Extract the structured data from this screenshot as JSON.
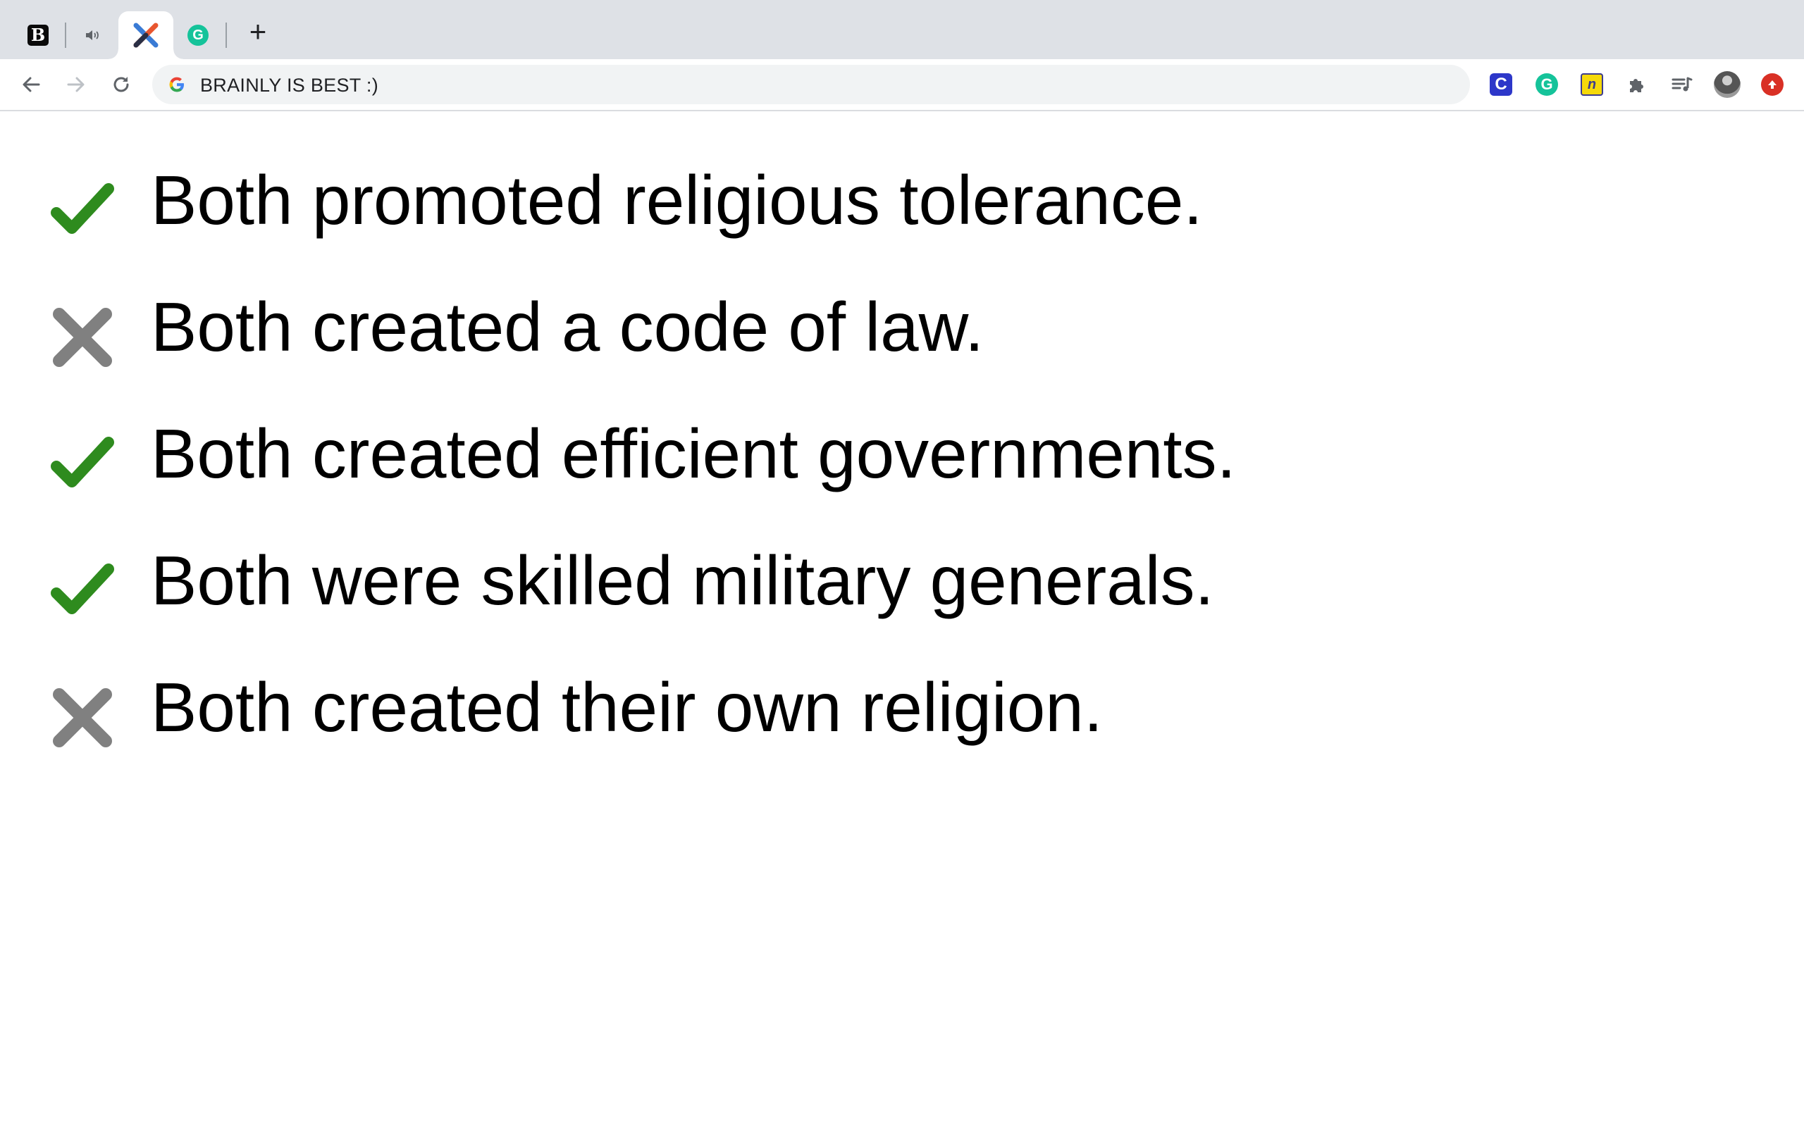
{
  "browser": {
    "tabs": [
      {
        "icon": "brainly-b-icon",
        "glyph": "B"
      },
      {
        "icon": "speaker-icon",
        "glyph": "🔈"
      },
      {
        "icon": "x-logo-icon",
        "active": true
      },
      {
        "icon": "grammarly-icon",
        "glyph": "G"
      }
    ],
    "new_tab_label": "+",
    "address_bar": {
      "search_engine_glyph": "G",
      "text": "BRAINLY IS BEST :)"
    },
    "extensions": [
      {
        "icon": "c-extension-icon",
        "glyph": "C",
        "color": "#2d37c9"
      },
      {
        "icon": "grammarly-extension-icon",
        "glyph": "G",
        "color": "#15c39a"
      },
      {
        "icon": "n-extension-icon",
        "glyph": "n",
        "color": "#f5d90a"
      },
      {
        "icon": "puzzle-icon"
      },
      {
        "icon": "media-queue-icon"
      },
      {
        "icon": "profile-avatar"
      },
      {
        "icon": "update-icon",
        "color": "#d93025"
      }
    ]
  },
  "answers": [
    {
      "text": "Both promoted religious tolerance.",
      "status": "correct",
      "icon": "checkmark-icon"
    },
    {
      "text": "Both created a code of law.",
      "status": "incorrect",
      "icon": "x-mark-icon"
    },
    {
      "text": "Both created efficient governments.",
      "status": "correct",
      "icon": "checkmark-icon"
    },
    {
      "text": "Both were skilled military generals.",
      "status": "correct",
      "icon": "checkmark-icon"
    },
    {
      "text": "Both created their own religion.",
      "status": "incorrect",
      "icon": "x-mark-icon"
    }
  ],
  "colors": {
    "correct": "#2e8b1e",
    "incorrect": "#808080",
    "tabstrip": "#dee1e6",
    "omnibox": "#f1f3f4"
  }
}
